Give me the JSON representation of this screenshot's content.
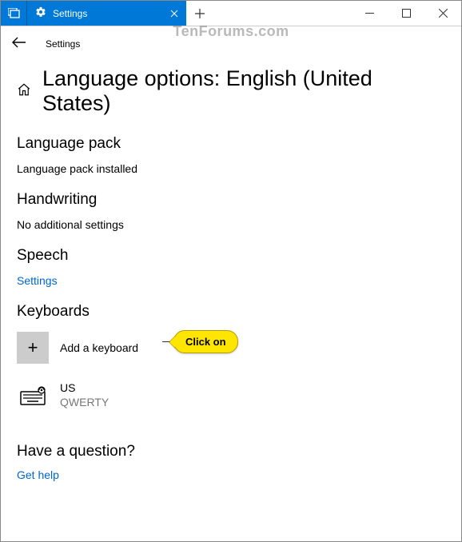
{
  "watermark": "TenForums.com",
  "titlebar": {
    "tab_title": "Settings"
  },
  "nav": {
    "label": "Settings"
  },
  "page": {
    "title": "Language options: English (United States)"
  },
  "sections": {
    "language_pack": {
      "heading": "Language pack",
      "body": "Language pack installed"
    },
    "handwriting": {
      "heading": "Handwriting",
      "body": "No additional settings"
    },
    "speech": {
      "heading": "Speech",
      "link": "Settings"
    },
    "keyboards": {
      "heading": "Keyboards",
      "add_label": "Add a keyboard",
      "items": [
        {
          "name": "US",
          "layout": "QWERTY"
        }
      ]
    },
    "question": {
      "heading": "Have a question?",
      "link": "Get help"
    }
  },
  "callout": {
    "text": "Click on"
  }
}
